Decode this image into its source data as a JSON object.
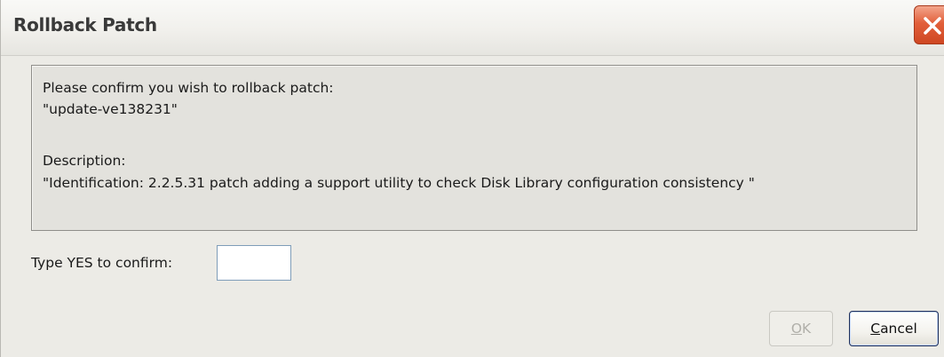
{
  "window": {
    "title": "Rollback Patch",
    "close_icon": "close-icon"
  },
  "message": {
    "line1": "Please confirm you wish to rollback patch:",
    "line2": "\"update-ve138231\"",
    "line3": "Description:",
    "line4": "\"Identification: 2.2.5.31 patch adding a support utility to check Disk Library configuration consistency \""
  },
  "confirm": {
    "label": "Type YES to confirm:",
    "value": ""
  },
  "buttons": {
    "ok_mnemonic": "O",
    "ok_rest": "K",
    "cancel_mnemonic": "C",
    "cancel_rest": "ancel"
  },
  "colors": {
    "close_button": "#e2603b",
    "dialog_background": "#ecebe6"
  }
}
